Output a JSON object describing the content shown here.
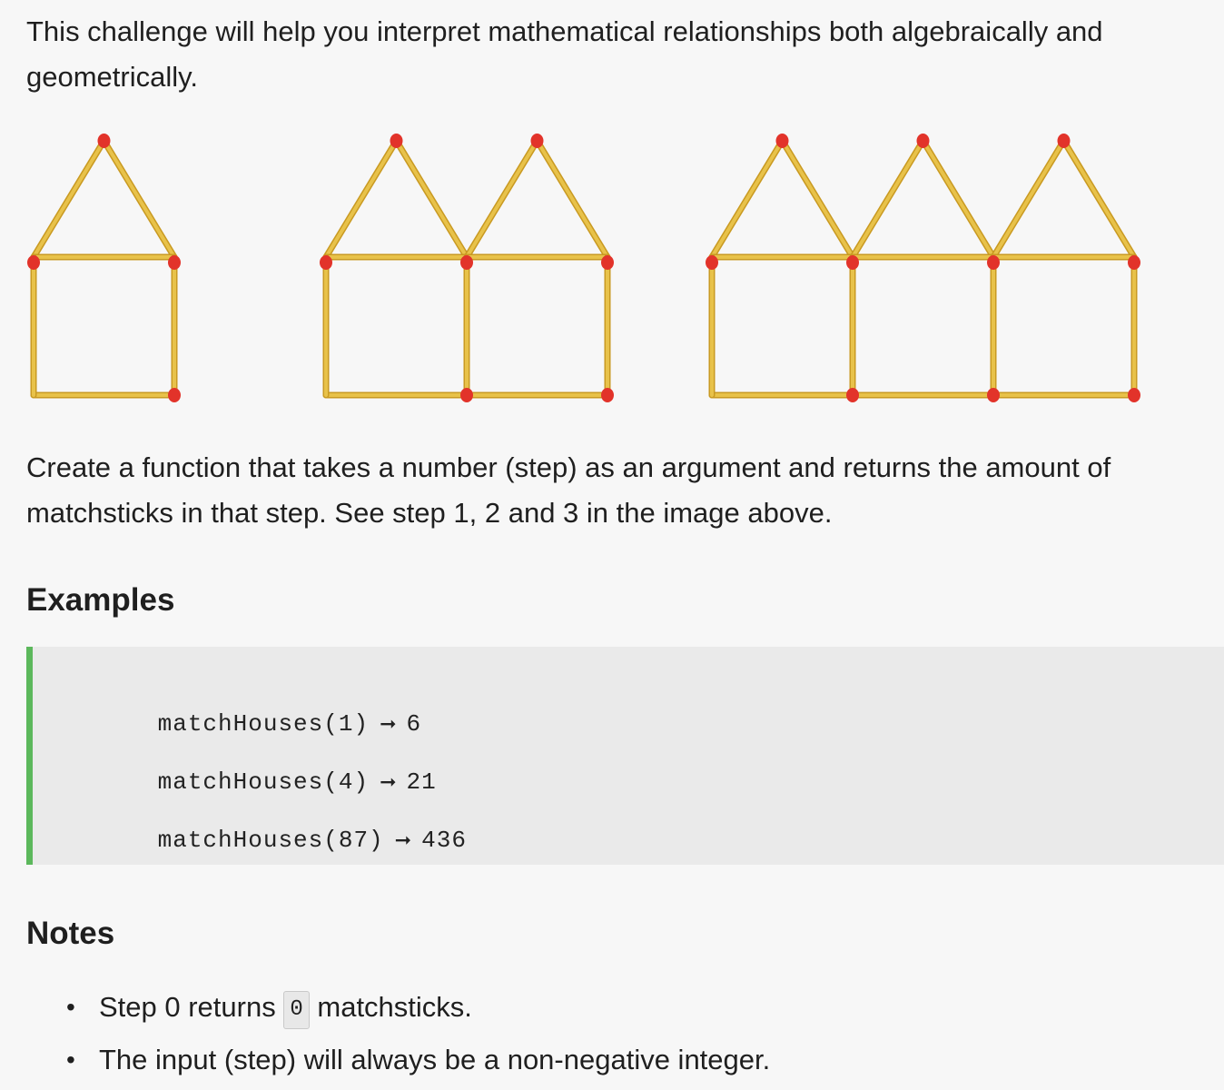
{
  "intro": {
    "text": "This challenge will help you interpret mathematical relationships both algebraically and geometrically."
  },
  "figure": {
    "houses_per_step": [
      1,
      2,
      3
    ],
    "colors": {
      "stick": "#e8c24a",
      "stick_edge": "#c99a22",
      "match_head": "#e2332a"
    }
  },
  "description": {
    "text": "Create a function that takes a number (step) as an argument and returns the amount of matchsticks in that step. See step 1, 2 and 3 in the image above."
  },
  "examples": {
    "heading": "Examples",
    "accent_color": "#5cb85c",
    "items": [
      {
        "call": "matchHouses(1)",
        "arrow": "➞",
        "result": "6"
      },
      {
        "call": "matchHouses(4)",
        "arrow": "➞",
        "result": "21"
      },
      {
        "call": "matchHouses(87)",
        "arrow": "➞",
        "result": "436"
      }
    ]
  },
  "notes": {
    "heading": "Notes",
    "items": [
      {
        "bullet": "•",
        "before": "Step 0 returns",
        "code": "0",
        "after": "matchsticks."
      },
      {
        "bullet": "•",
        "text": "The input (step) will always be a non-negative integer."
      }
    ]
  }
}
